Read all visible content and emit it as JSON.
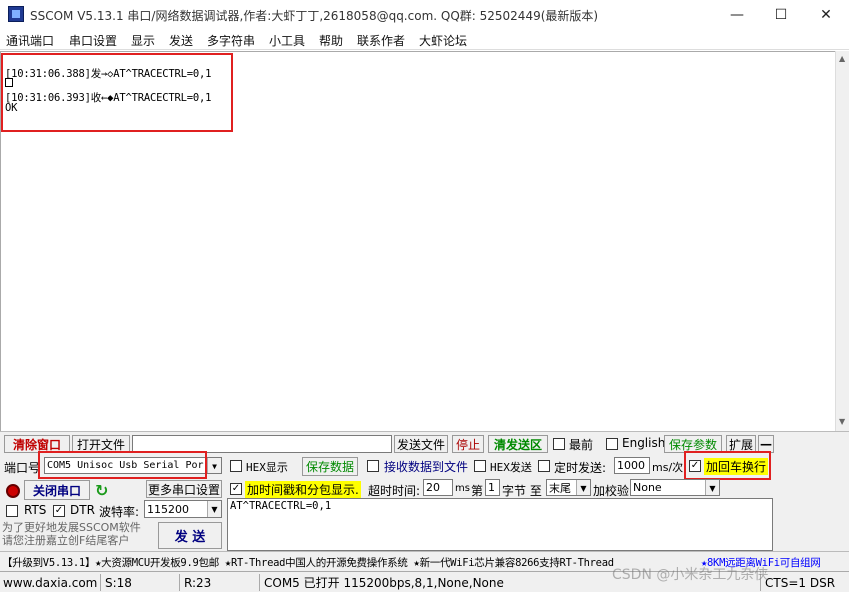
{
  "window": {
    "title": "SSCOM V5.13.1 串口/网络数据调试器,作者:大虾丁丁,2618058@qq.com. QQ群: 52502449(最新版本)",
    "minimize": "—",
    "maximize": "☐",
    "close": "✕"
  },
  "menu": [
    "通讯端口",
    "串口设置",
    "显示",
    "发送",
    "多字符串",
    "小工具",
    "帮助",
    "联系作者",
    "大虾论坛"
  ],
  "receive": {
    "line1": "[10:31:06.388]发→◇AT^TRACECTRL=0,1",
    "line3": "[10:31:06.393]收←◆AT^TRACECTRL=0,1",
    "line4": "OK"
  },
  "toolbar": {
    "clear_window": "清除窗口",
    "open_file": "打开文件",
    "send_file": "发送文件",
    "stop": "停止",
    "clear_send": "清发送区",
    "topmost": "最前",
    "english": "English",
    "save_params": "保存参数",
    "expand": "扩展",
    "collapse": "—"
  },
  "port": {
    "label": "端口号",
    "value": "COM5 Unisoc Usb Serial Por",
    "hex_display": "HEX显示",
    "save_data": "保存数据",
    "recv_to_file": "接收数据到文件",
    "hex_send": "HEX发送",
    "timed_send": "定时发送:",
    "interval": "1000",
    "interval_unit": "ms/次",
    "add_crlf": "加回车换行"
  },
  "row3": {
    "close_port": "关闭串口",
    "more_settings": "更多串口设置",
    "timestamp": "加时间戳和分包显示.",
    "timeout_label": "超时时间:",
    "timeout": "20",
    "timeout_unit": "ms",
    "nth_label": "第",
    "nth": "1",
    "byte_label": "字节 至",
    "end_value": "末尾",
    "checksum_label": "加校验",
    "checksum_value": "None"
  },
  "row4": {
    "rts": "RTS",
    "dtr": "DTR",
    "baud_label": "波特率:",
    "baud": "115200"
  },
  "send": {
    "text": "AT^TRACECTRL=0,1",
    "promo": "为了更好地发展SSCOM软件\n请您注册嘉立创F结尾客户",
    "send_button": "发 送"
  },
  "ticker": {
    "text": "【升级到V5.13.1】★大资源MCU开发板9.9包邮 ★RT-Thread中国人的开源免费操作系统 ★新一代WiFi芯片兼容8266支持RT-Thread ",
    "link": "★8KM远距离WiFi可自组网"
  },
  "status": {
    "site": "www.daxia.com",
    "sent": "S:18",
    "received": "R:23",
    "port_state": "COM5 已打开  115200bps,8,1,None,None",
    "watermark": "CSDN @小米杂工九杂侠",
    "lines": "CTS=1 DSR"
  },
  "colors": {
    "highlight_red": "#e02020",
    "highlight_yellow": "#ffff00",
    "link_blue": "#0000ff"
  }
}
